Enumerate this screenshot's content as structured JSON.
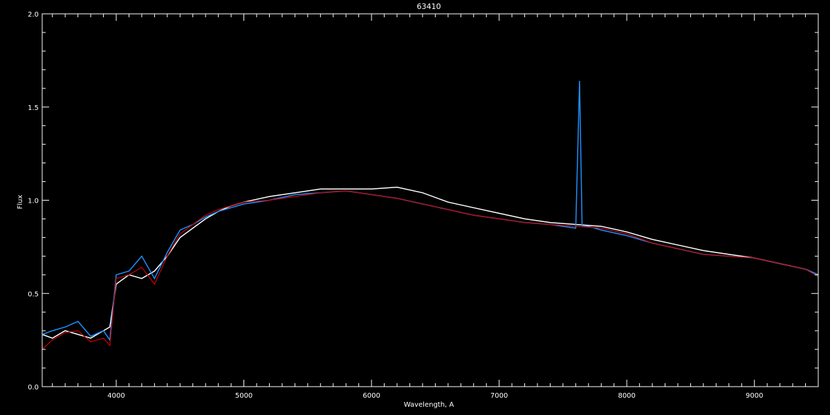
{
  "chart_data": {
    "type": "line",
    "title": "63410",
    "xlabel": "Wavelength, A",
    "ylabel": "Flux",
    "xlim": [
      3420,
      9500
    ],
    "ylim": [
      0.0,
      2.0
    ],
    "x_ticks": [
      "4000",
      "5000",
      "6000",
      "7000",
      "8000",
      "9000"
    ],
    "y_ticks": [
      "0.0",
      "0.5",
      "1.0",
      "1.5",
      "2.0"
    ],
    "grid": false,
    "background_color": "#000000",
    "colors": {
      "axes": "#ffffff",
      "white_series": "#ffffff",
      "blue_series": "#1e90ff",
      "red_series": "#cc0000"
    },
    "series": [
      {
        "color": "#ffffff",
        "x": [
          3420,
          3500,
          3600,
          3700,
          3800,
          3900,
          3950,
          4000,
          4100,
          4200,
          4300,
          4400,
          4500,
          4600,
          4700,
          4800,
          4900,
          5000,
          5200,
          5400,
          5600,
          5800,
          6000,
          6200,
          6400,
          6600,
          6800,
          7000,
          7200,
          7400,
          7600,
          7800,
          8000,
          8200,
          8400,
          8600,
          8800,
          9000,
          9200,
          9400,
          9500
        ],
        "y": [
          0.28,
          0.26,
          0.3,
          0.28,
          0.26,
          0.3,
          0.32,
          0.55,
          0.6,
          0.58,
          0.62,
          0.7,
          0.8,
          0.85,
          0.9,
          0.94,
          0.97,
          0.99,
          1.02,
          1.04,
          1.06,
          1.06,
          1.06,
          1.07,
          1.04,
          0.99,
          0.96,
          0.93,
          0.9,
          0.88,
          0.87,
          0.86,
          0.83,
          0.79,
          0.76,
          0.73,
          0.71,
          0.69,
          0.66,
          0.63,
          0.6
        ]
      },
      {
        "color": "#1e90ff",
        "x": [
          3420,
          3500,
          3600,
          3700,
          3800,
          3900,
          3950,
          4000,
          4100,
          4200,
          4300,
          4400,
          4500,
          4600,
          4700,
          4800,
          4900,
          5000,
          5200,
          5400,
          5600,
          5800,
          6000,
          6200,
          6400,
          6600,
          6800,
          7000,
          7200,
          7400,
          7600,
          7630,
          7650,
          7700,
          7800,
          8000,
          8200,
          8400,
          8600,
          8800,
          9000,
          9200,
          9400,
          9500
        ],
        "y": [
          0.28,
          0.3,
          0.32,
          0.35,
          0.27,
          0.3,
          0.25,
          0.6,
          0.62,
          0.7,
          0.58,
          0.72,
          0.84,
          0.87,
          0.91,
          0.94,
          0.96,
          0.98,
          1.0,
          1.03,
          1.04,
          1.05,
          1.03,
          1.01,
          0.98,
          0.95,
          0.92,
          0.9,
          0.88,
          0.87,
          0.85,
          1.64,
          0.86,
          0.86,
          0.84,
          0.81,
          0.77,
          0.74,
          0.71,
          0.7,
          0.69,
          0.66,
          0.63,
          0.6
        ]
      },
      {
        "color": "#cc0000",
        "x": [
          3420,
          3500,
          3600,
          3700,
          3800,
          3900,
          3950,
          4000,
          4100,
          4200,
          4300,
          4400,
          4500,
          4600,
          4700,
          4800,
          4900,
          5000,
          5200,
          5400,
          5600,
          5800,
          6000,
          6200,
          6400,
          6600,
          6800,
          7000,
          7200,
          7400,
          7600,
          7800,
          8000,
          8200,
          8400,
          8600,
          8800,
          9000,
          9200,
          9400,
          9500
        ],
        "y": [
          0.2,
          0.25,
          0.29,
          0.3,
          0.24,
          0.26,
          0.22,
          0.58,
          0.6,
          0.64,
          0.55,
          0.7,
          0.82,
          0.87,
          0.92,
          0.95,
          0.97,
          0.99,
          1.0,
          1.02,
          1.04,
          1.05,
          1.03,
          1.01,
          0.98,
          0.95,
          0.92,
          0.9,
          0.88,
          0.87,
          0.86,
          0.85,
          0.82,
          0.77,
          0.74,
          0.71,
          0.7,
          0.69,
          0.66,
          0.63,
          0.59
        ]
      }
    ]
  }
}
